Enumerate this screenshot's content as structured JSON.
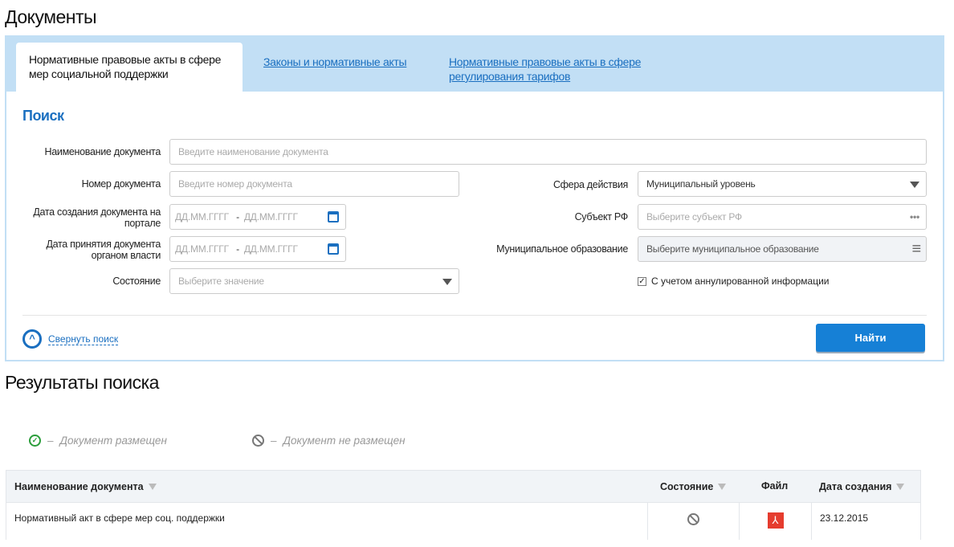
{
  "page": {
    "title": "Документы"
  },
  "tabs": [
    {
      "label": "Нормативные правовые акты в сфере мер социальной поддержки",
      "active": true
    },
    {
      "label": "Законы и нормативные акты"
    },
    {
      "label": "Нормативные правовые акты в сфере регулирования тарифов"
    }
  ],
  "search": {
    "title": "Поиск",
    "doc_name": {
      "label": "Наименование документа",
      "placeholder": "Введите наименование документа"
    },
    "doc_number": {
      "label": "Номер документа",
      "placeholder": "Введите номер документа"
    },
    "created_date": {
      "label": "Дата создания документа на портале",
      "from": "ДД.ММ.ГГГГ",
      "to": "ДД.ММ.ГГГГ"
    },
    "adopted_date": {
      "label": "Дата принятия документа органом власти",
      "from": "ДД.ММ.ГГГГ",
      "to": "ДД.ММ.ГГГГ"
    },
    "state": {
      "label": "Состояние",
      "placeholder": "Выберите значение"
    },
    "scope": {
      "label": "Сфера действия",
      "value": "Муниципальный уровень"
    },
    "subject": {
      "label": "Субъект РФ",
      "placeholder": "Выберите субъект РФ"
    },
    "municipality": {
      "label": "Муниципальное образование",
      "placeholder": "Выберите муниципальное образование"
    },
    "annulled": {
      "label": "С учетом аннулированной информации",
      "checked": true
    },
    "collapse_label": "Свернуть поиск",
    "submit_label": "Найти",
    "dash": "-"
  },
  "results": {
    "title": "Результаты поиска",
    "legend": [
      {
        "icon": "check-circle-icon",
        "sep": "–",
        "text": "Документ размещен"
      },
      {
        "icon": "ban-icon",
        "sep": "–",
        "text": "Документ не размещен"
      }
    ],
    "columns": [
      "Наименование документа",
      "Состояние",
      "Файл",
      "Дата создания"
    ],
    "rows": [
      {
        "name": "Нормативный акт в сфере мер соц. поддержки",
        "state": "not-posted",
        "file": "pdf",
        "date": "23.12.2015"
      }
    ]
  },
  "colors": {
    "accent": "#1680d6",
    "tabbar": "#c2dff5",
    "pdf": "#e53c2e",
    "ok": "#2a9d3a"
  }
}
